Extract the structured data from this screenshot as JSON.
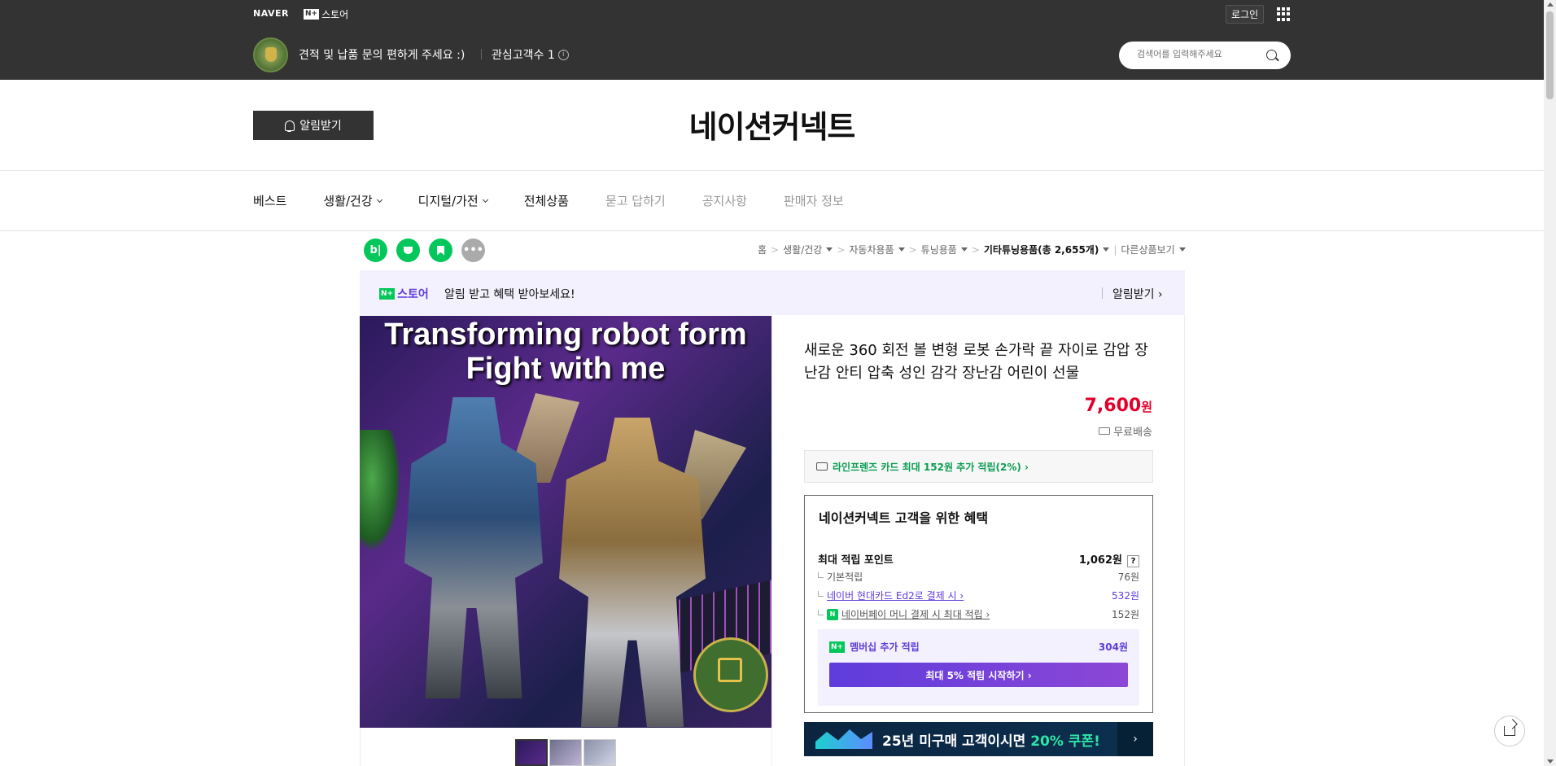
{
  "top": {
    "naver": "NAVER",
    "nplus_box": "N+",
    "nplus_label": "스토어",
    "login": "로그인",
    "store_desc": "견적 및 납품 문의 편하게 주세요 :)",
    "fav_label": "관심고객수 1",
    "search_placeholder": "검색어를 입력해주세요"
  },
  "store": {
    "title": "네이션커넥트",
    "alarm_btn": "알림받기"
  },
  "nav": {
    "items": [
      "베스트",
      "생활/건강",
      "디지털/가전",
      "전체상품",
      "묻고 답하기",
      "공지사항",
      "판매자 정보"
    ]
  },
  "share": {
    "blog": "b|"
  },
  "breadcrumb": {
    "home": "홈",
    "c1": "생활/건강",
    "c2": "자동차용품",
    "c3": "튜닝용품",
    "c4": "기타튜닝용품(총 2,655개)",
    "other": "다른상품보기"
  },
  "promo": {
    "logo_n": "N+",
    "logo_text": "스토어",
    "text": "알림 받고 혜택 받아보세요!",
    "link": "알림받기 ›"
  },
  "image": {
    "headline1": "Transforming robot form",
    "headline2": "Fight with me"
  },
  "product": {
    "title": "새로운 360 회전 볼 변형 로봇 손가락 끝 자이로 감압 장난감 안티 압축 성인 감각 장난감 어린이 선물",
    "price": "7,600",
    "price_unit": "원",
    "shipping": "무료배송",
    "card_offer": "라인프렌즈 카드 최대 152원 추가 적립(2%) ›"
  },
  "benefit": {
    "title": "네이션커넥트 고객을 위한 혜택",
    "max_label": "최대 적립 포인트",
    "max_value": "1,062원",
    "qmark": "?",
    "rows": [
      {
        "label": "기본적립",
        "value": "76원"
      },
      {
        "label": "네이버 현대카드 Ed2로 결제 시 ›",
        "value": "532원"
      },
      {
        "label": "네이버페이 머니 결제 시 최대 적립 ›",
        "value": "152원"
      }
    ],
    "npay_badge": "N",
    "member_label": "멤버십 추가 적립",
    "member_value": "304원",
    "member_btn": "최대 5% 적립 시작하기 ›"
  },
  "banner": {
    "text_pre": "25년 미구매 고객이시면 ",
    "text_em": "20% 쿠폰!",
    "arrow": "›"
  }
}
